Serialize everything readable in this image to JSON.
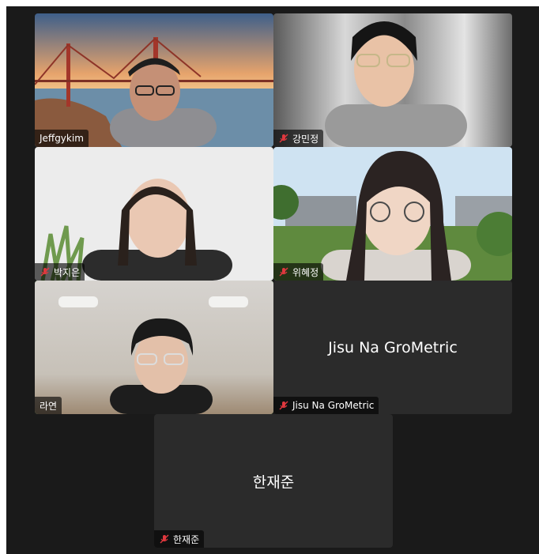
{
  "participants": [
    {
      "name": "Jeffgykim",
      "muted": false
    },
    {
      "name": "강민정",
      "muted": true
    },
    {
      "name": "박지은",
      "muted": true
    },
    {
      "name": "위혜정",
      "muted": true
    },
    {
      "name": "라연",
      "muted": false,
      "speaking": true
    },
    {
      "name": "Jisu Na GroMetric",
      "display_name": "Jisu Na GroMetric",
      "muted": true,
      "video": false
    },
    {
      "name": "한재준",
      "display_name": "한재준",
      "muted": true,
      "video": false
    }
  ],
  "colors": {
    "window_bg": "#1a1a1a",
    "avatar_tile_bg": "#2b2b2b",
    "active_speaker_border": "#5ec05a",
    "muted_icon": "#e0383e"
  }
}
